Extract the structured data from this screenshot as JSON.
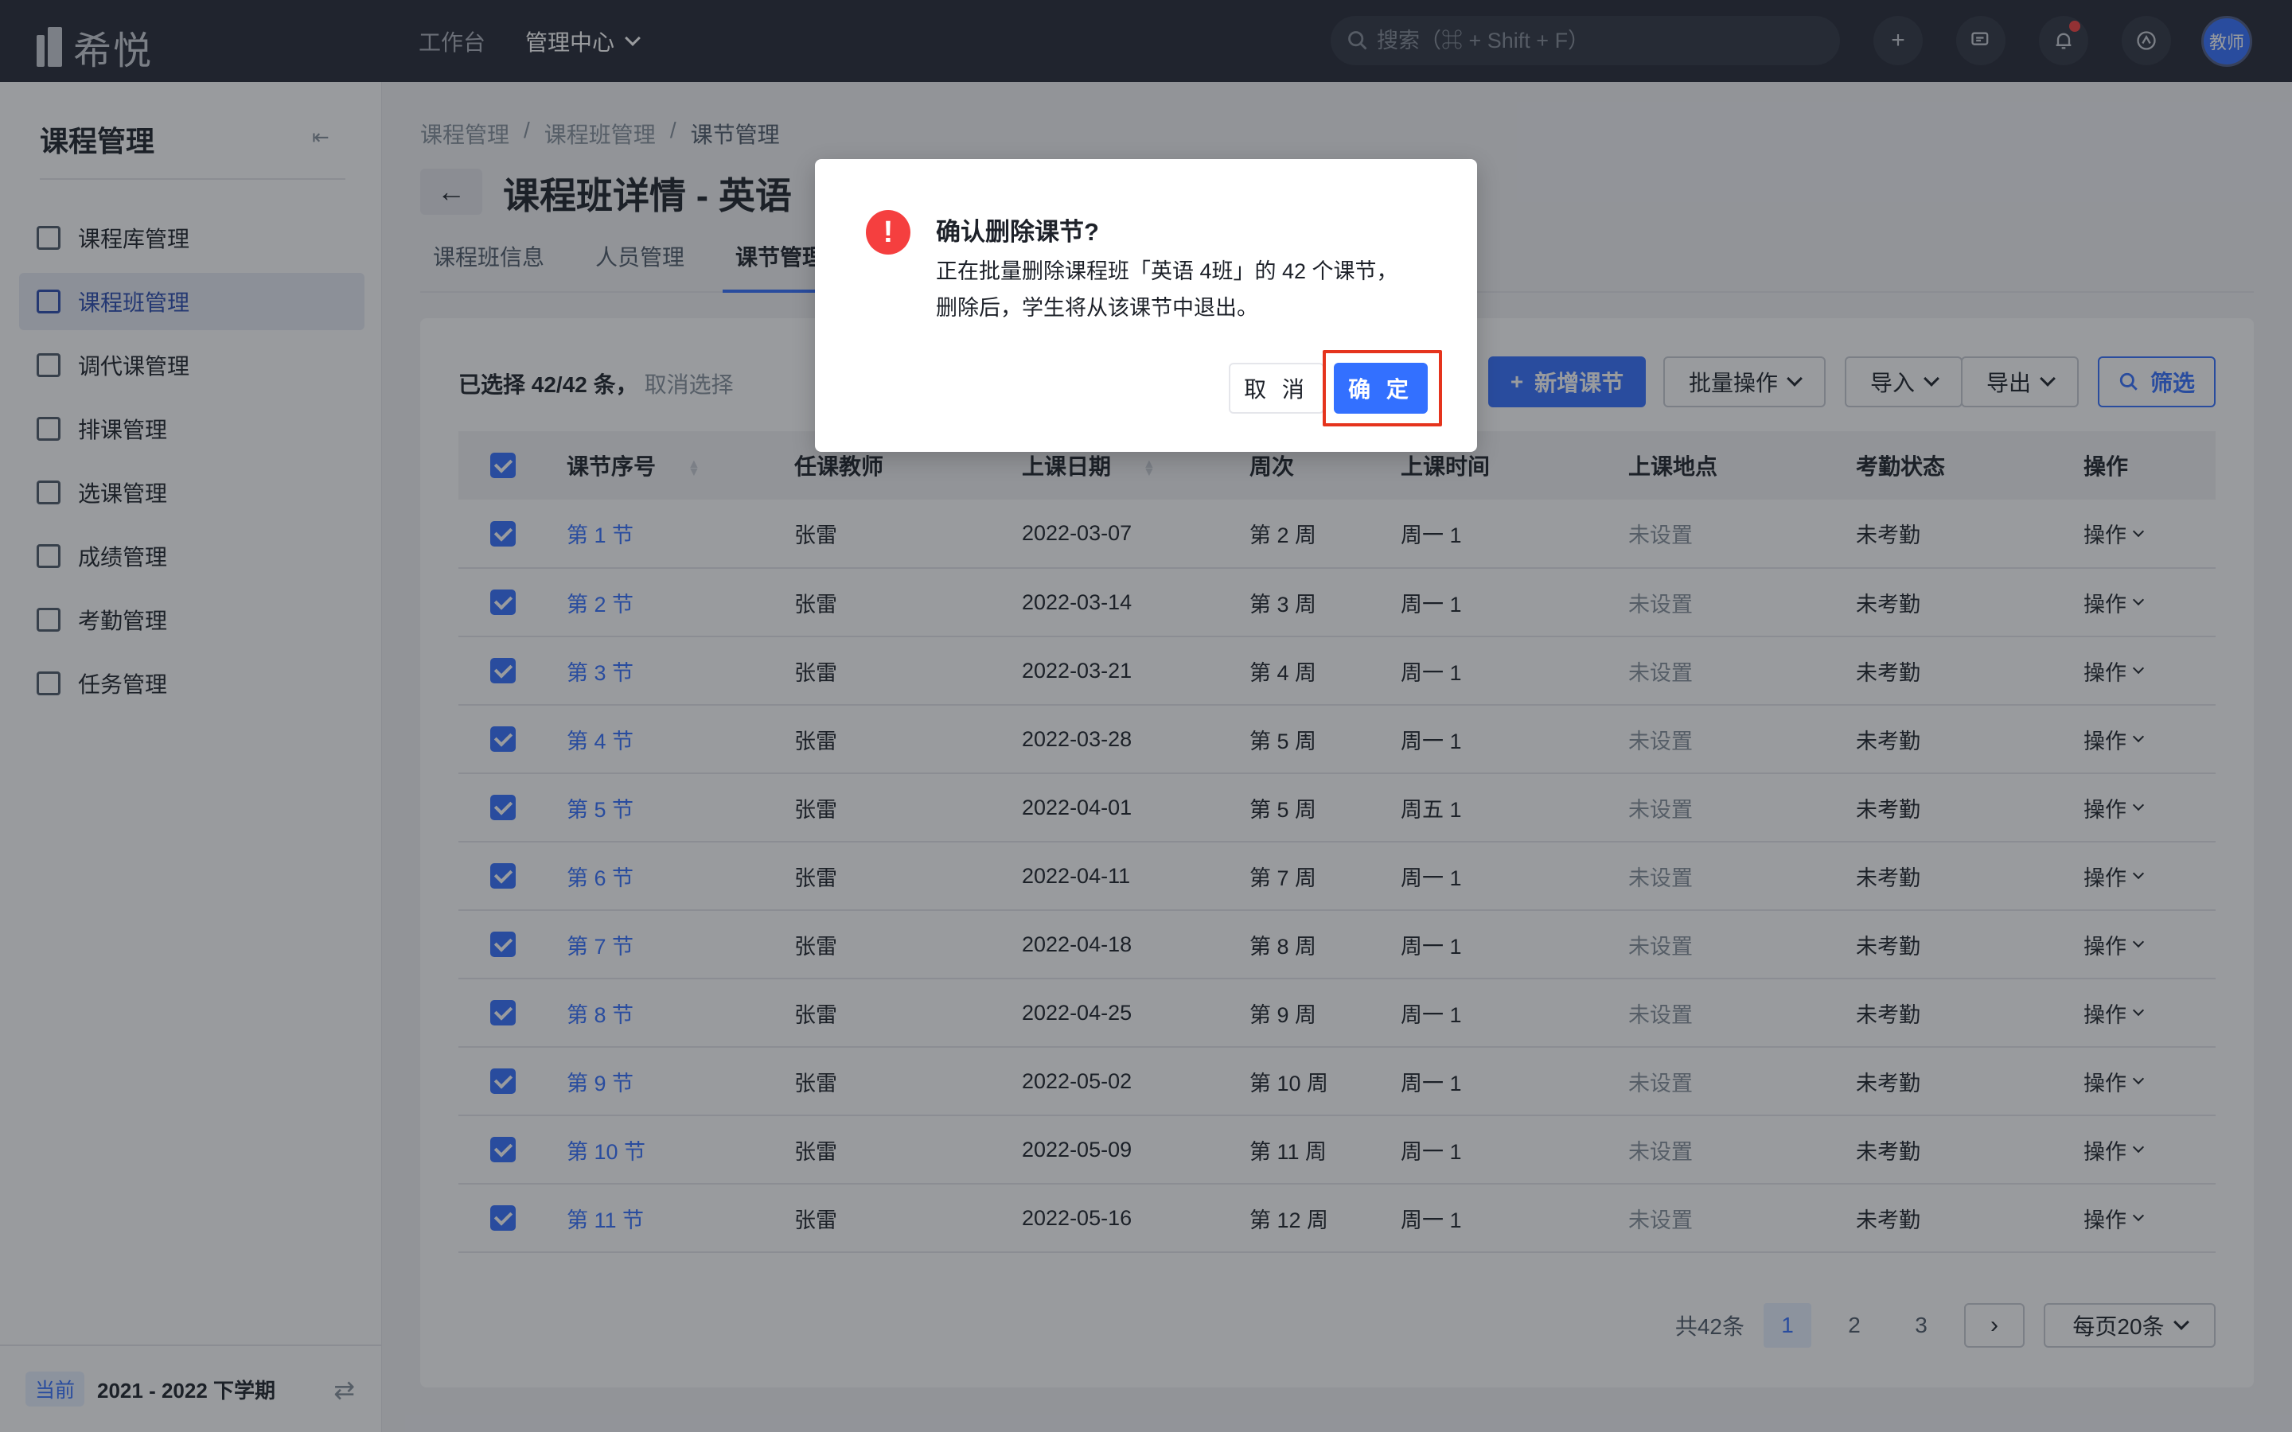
{
  "app": {
    "logo_text": "希悦"
  },
  "topnav": {
    "items": [
      {
        "label": "工作台"
      },
      {
        "label": "管理中心"
      }
    ]
  },
  "search": {
    "placeholder": "搜索（⌘ + Shift + F）"
  },
  "topbar_icons": [
    "plus-icon",
    "message-icon",
    "bell-icon",
    "app-icon"
  ],
  "user": {
    "avatar_label": "教师"
  },
  "sidebar": {
    "title": "课程管理",
    "items": [
      {
        "label": "课程库管理",
        "icon": "course-library-icon",
        "active": false
      },
      {
        "label": "课程班管理",
        "icon": "class-icon",
        "active": true
      },
      {
        "label": "调代课管理",
        "icon": "substitute-icon",
        "active": false
      },
      {
        "label": "排课管理",
        "icon": "schedule-icon",
        "active": false
      },
      {
        "label": "选课管理",
        "icon": "select-course-icon",
        "active": false
      },
      {
        "label": "成绩管理",
        "icon": "grade-icon",
        "active": false
      },
      {
        "label": "考勤管理",
        "icon": "attendance-icon",
        "active": false
      },
      {
        "label": "任务管理",
        "icon": "task-icon",
        "active": false
      }
    ],
    "footer": {
      "badge": "当前",
      "term": "2021 - 2022 下学期"
    }
  },
  "breadcrumb": [
    "课程管理",
    "/",
    "课程班管理",
    "/",
    "课节管理"
  ],
  "page": {
    "title": "课程班详情 - 英语"
  },
  "tabs": [
    "课程班信息",
    "人员管理",
    "课节管理"
  ],
  "toolbar": {
    "selection": "已选择 42/42 条，",
    "cancel_selection": "取消选择",
    "add": "新增课节",
    "batch": "批量操作",
    "import": "导入",
    "export": "导出",
    "filter": "筛选"
  },
  "table": {
    "columns": [
      "课节序号",
      "任课教师",
      "上课日期",
      "周次",
      "上课时间",
      "上课地点",
      "考勤状态",
      "操作"
    ],
    "rows": [
      {
        "seq": "第 1 节",
        "teacher": "张雷",
        "date": "2022-03-07",
        "week": "第 2 周",
        "time": "周一 1",
        "place": "未设置",
        "status": "未考勤",
        "op": "操作"
      },
      {
        "seq": "第 2 节",
        "teacher": "张雷",
        "date": "2022-03-14",
        "week": "第 3 周",
        "time": "周一 1",
        "place": "未设置",
        "status": "未考勤",
        "op": "操作"
      },
      {
        "seq": "第 3 节",
        "teacher": "张雷",
        "date": "2022-03-21",
        "week": "第 4 周",
        "time": "周一 1",
        "place": "未设置",
        "status": "未考勤",
        "op": "操作"
      },
      {
        "seq": "第 4 节",
        "teacher": "张雷",
        "date": "2022-03-28",
        "week": "第 5 周",
        "time": "周一 1",
        "place": "未设置",
        "status": "未考勤",
        "op": "操作"
      },
      {
        "seq": "第 5 节",
        "teacher": "张雷",
        "date": "2022-04-01",
        "week": "第 5 周",
        "time": "周五 1",
        "place": "未设置",
        "status": "未考勤",
        "op": "操作"
      },
      {
        "seq": "第 6 节",
        "teacher": "张雷",
        "date": "2022-04-11",
        "week": "第 7 周",
        "time": "周一 1",
        "place": "未设置",
        "status": "未考勤",
        "op": "操作"
      },
      {
        "seq": "第 7 节",
        "teacher": "张雷",
        "date": "2022-04-18",
        "week": "第 8 周",
        "time": "周一 1",
        "place": "未设置",
        "status": "未考勤",
        "op": "操作"
      },
      {
        "seq": "第 8 节",
        "teacher": "张雷",
        "date": "2022-04-25",
        "week": "第 9 周",
        "time": "周一 1",
        "place": "未设置",
        "status": "未考勤",
        "op": "操作"
      },
      {
        "seq": "第 9 节",
        "teacher": "张雷",
        "date": "2022-05-02",
        "week": "第 10 周",
        "time": "周一 1",
        "place": "未设置",
        "status": "未考勤",
        "op": "操作"
      },
      {
        "seq": "第 10 节",
        "teacher": "张雷",
        "date": "2022-05-09",
        "week": "第 11 周",
        "time": "周一 1",
        "place": "未设置",
        "status": "未考勤",
        "op": "操作"
      },
      {
        "seq": "第 11 节",
        "teacher": "张雷",
        "date": "2022-05-16",
        "week": "第 12 周",
        "time": "周一 1",
        "place": "未设置",
        "status": "未考勤",
        "op": "操作"
      }
    ]
  },
  "pagination": {
    "total": "共42条",
    "pages": [
      "1",
      "2",
      "3"
    ],
    "current": "1",
    "page_size": "每页20条"
  },
  "dialog": {
    "title": "确认删除课节?",
    "body_line1": "正在批量删除课程班「英语 4班」的 42 个课节，",
    "body_line2": "删除后，学生将从该课节中退出。",
    "cancel": "取 消",
    "confirm": "确 定"
  },
  "colors": {
    "primary": "#3370ff",
    "danger": "#f53f3f",
    "topbar": "#232733",
    "highlight": "#e5341d"
  }
}
